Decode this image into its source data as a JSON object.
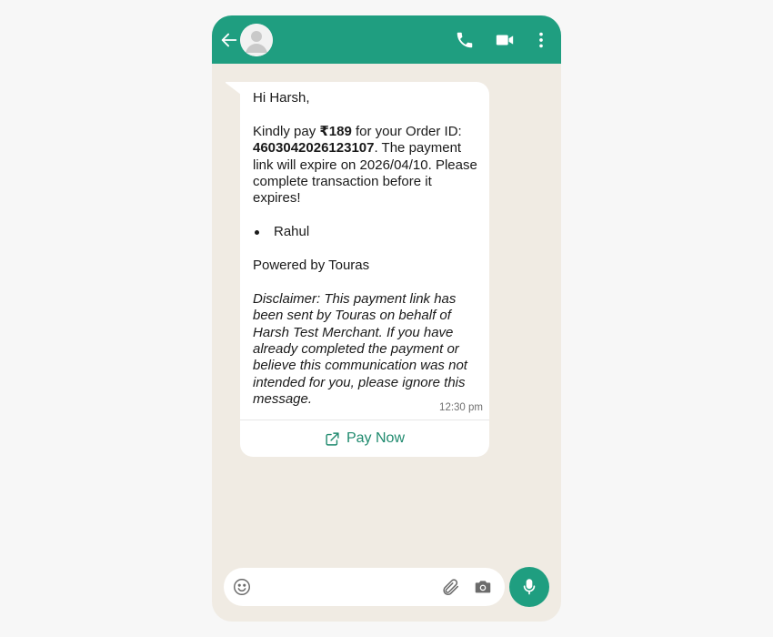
{
  "message": {
    "greeting": "Hi Harsh,",
    "para1_a": "Kindly pay ",
    "amount": "₹189",
    "para1_b": " for your Order ID: ",
    "order_id": "4603042026123107",
    "para1_c": ". The payment link will expire on 2026/04/10. Please complete transaction before it expires!",
    "bullet": "Rahul",
    "powered_by": "Powered by Touras",
    "disclaimer": "Disclaimer: This payment link has been sent by Touras on behalf of Harsh Test Merchant. If you have already completed the payment or believe this communication was not intended for you, please ignore this message.",
    "time": "12:30 pm",
    "button_label": "Pay Now"
  },
  "input": {
    "value": "",
    "placeholder": ""
  },
  "icons": {
    "back": "arrow-left-icon",
    "avatar": "user-avatar-icon",
    "call": "phone-icon",
    "video": "video-camera-icon",
    "menu": "more-vertical-icon",
    "external": "external-link-icon",
    "emoji": "emoji-icon",
    "attach": "paperclip-icon",
    "camera": "camera-icon",
    "mic": "microphone-icon"
  },
  "colors": {
    "header": "#1f9e80",
    "chat_background": "#f0ebe3",
    "bubble": "#ffffff",
    "link": "#1f8a6e",
    "mic_button": "#1f9e80"
  }
}
